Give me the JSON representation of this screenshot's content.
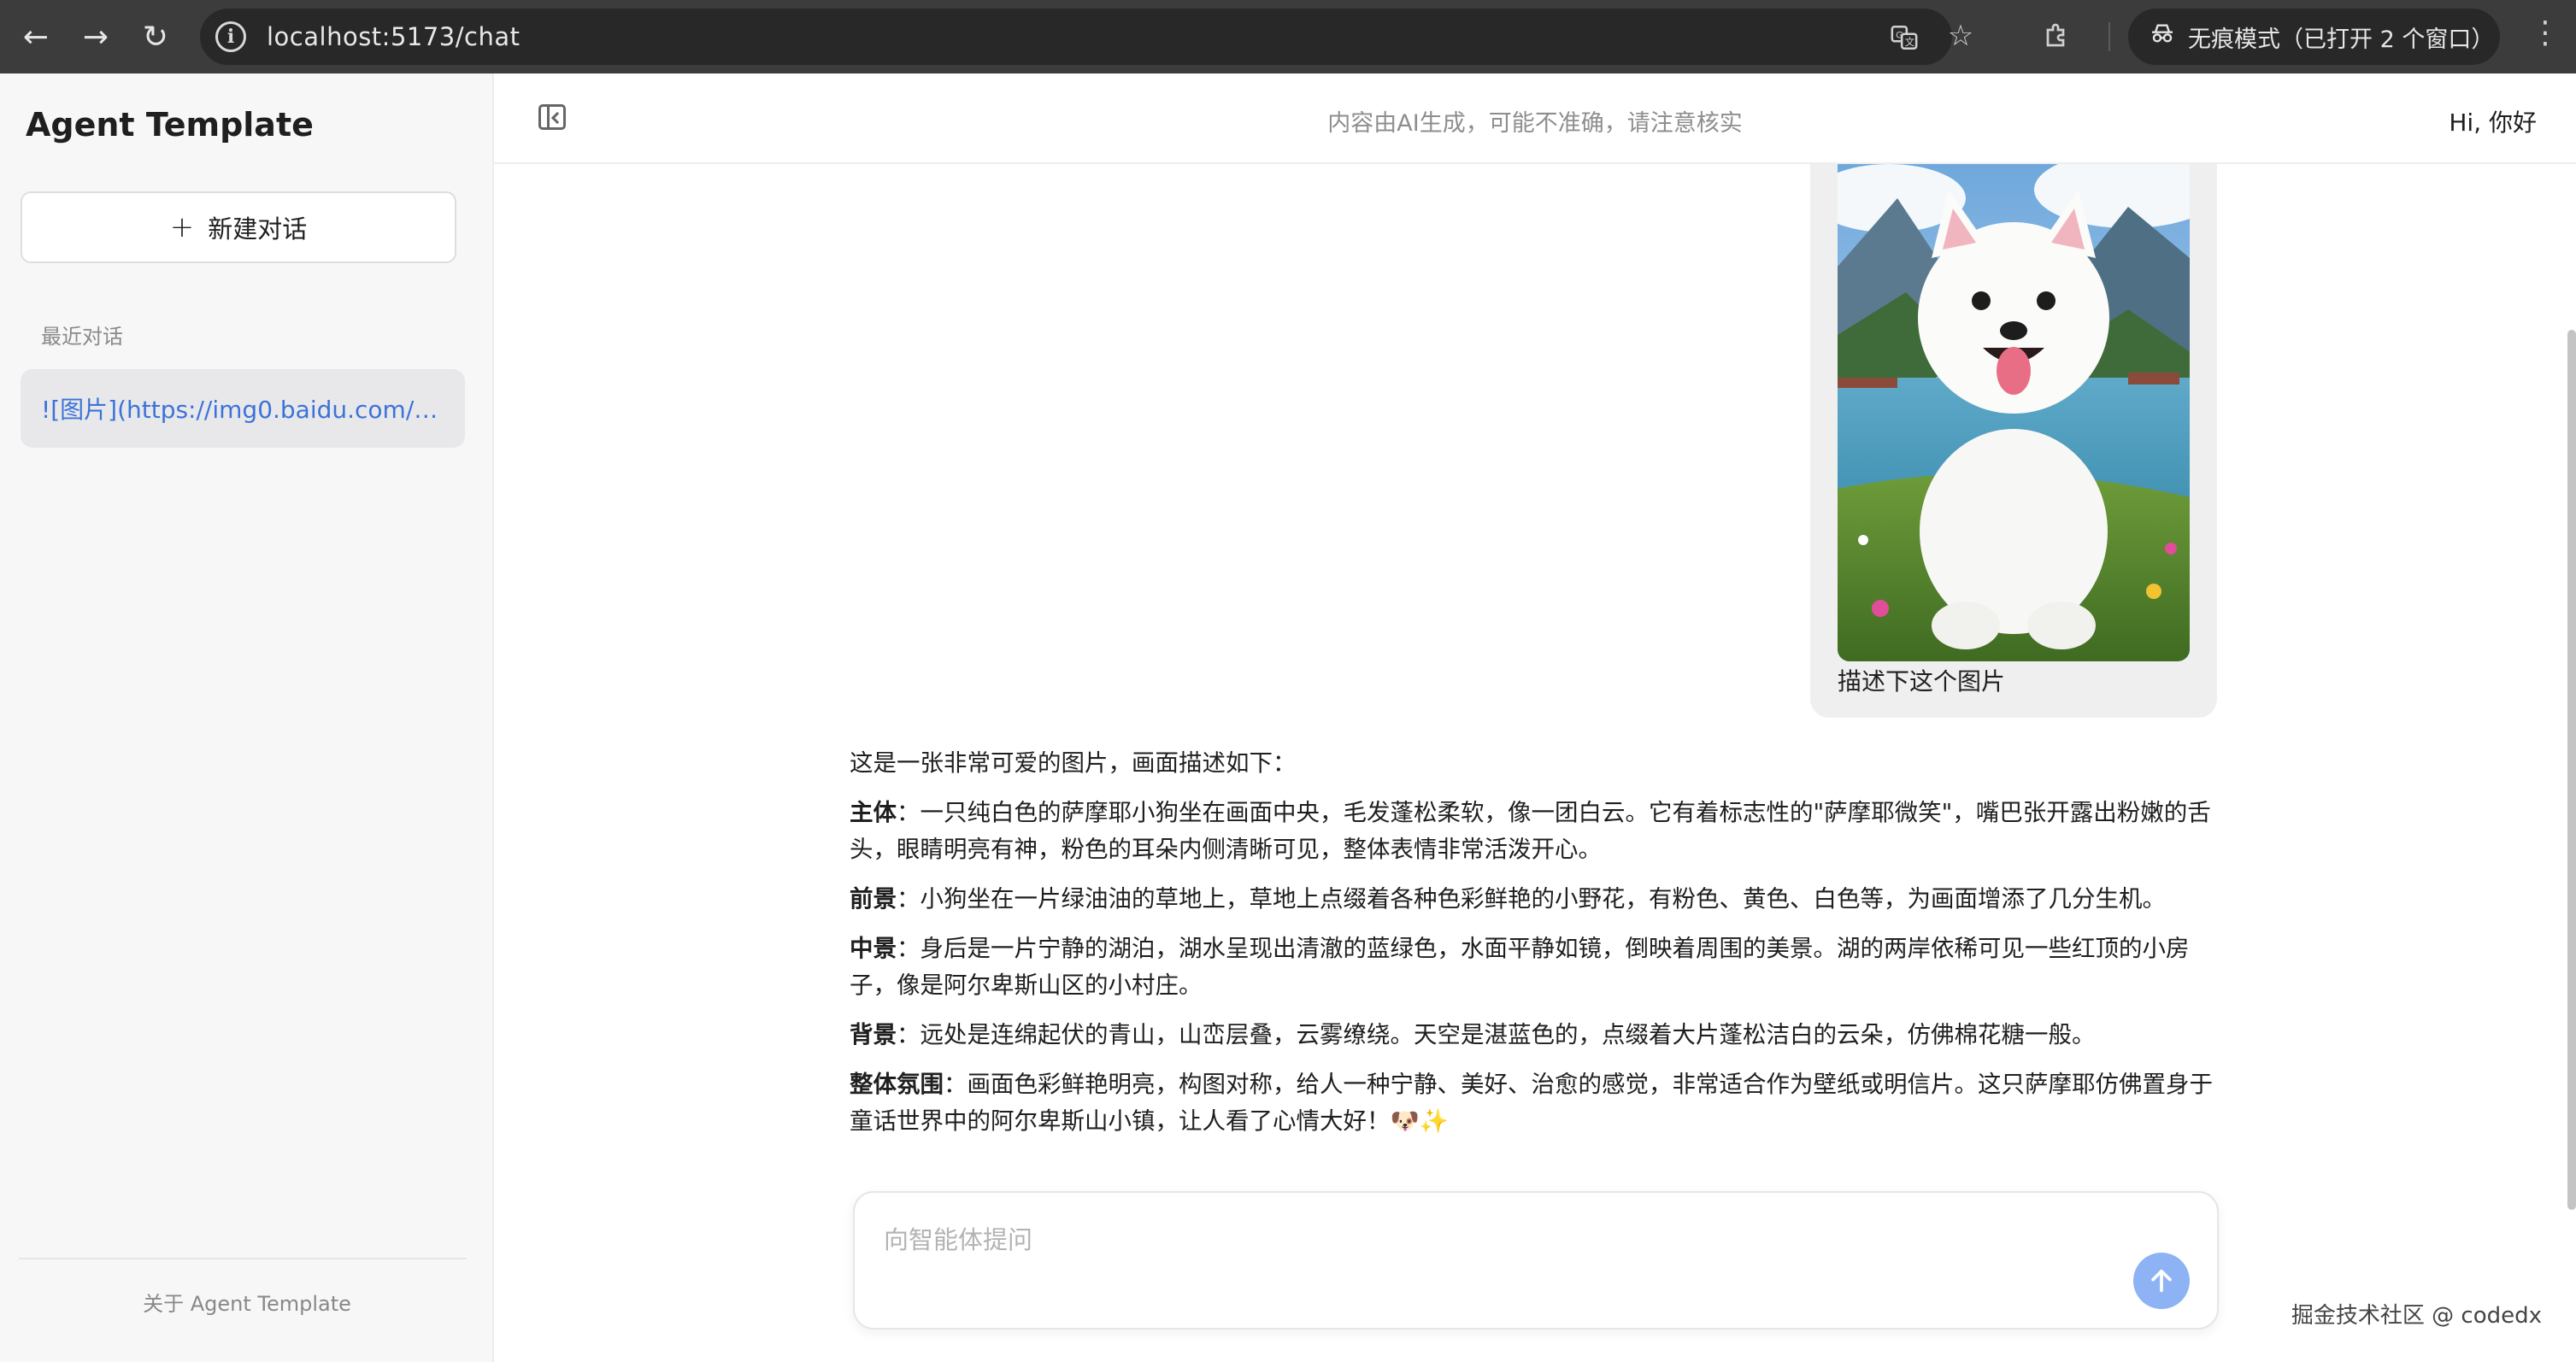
{
  "browser": {
    "back_icon": "arrow-left-icon",
    "forward_icon": "arrow-right-icon",
    "reload_icon": "reload-icon",
    "url": "localhost:5173/chat",
    "incognito_label": "无痕模式（已打开 2 个窗口）"
  },
  "sidebar": {
    "app_title": "Agent Template",
    "new_chat_label": "新建对话",
    "recent_label": "最近对话",
    "history": [
      {
        "label": "![图片](https://img0.baidu.com/it/u=..."
      }
    ],
    "about_label": "关于 Agent Template"
  },
  "header": {
    "disclaimer": "内容由AI生成，可能不准确，请注意核实",
    "greeting": "Hi, 你好"
  },
  "chat": {
    "user_message": {
      "image_alt": "white samoyed puppy sitting by a lake",
      "text": "描述下这个图片"
    },
    "answer": {
      "intro": "这是一张非常可爱的图片，画面描述如下：",
      "sections": [
        {
          "heading": "主体",
          "text": "：一只纯白色的萨摩耶小狗坐在画面中央，毛发蓬松柔软，像一团白云。它有着标志性的\"萨摩耶微笑\"，嘴巴张开露出粉嫩的舌头，眼睛明亮有神，粉色的耳朵内侧清晰可见，整体表情非常活泼开心。"
        },
        {
          "heading": "前景",
          "text": "：小狗坐在一片绿油油的草地上，草地上点缀着各种色彩鲜艳的小野花，有粉色、黄色、白色等，为画面增添了几分生机。"
        },
        {
          "heading": "中景",
          "text": "：身后是一片宁静的湖泊，湖水呈现出清澈的蓝绿色，水面平静如镜，倒映着周围的美景。湖的两岸依稀可见一些红顶的小房子，像是阿尔卑斯山区的小村庄。"
        },
        {
          "heading": "背景",
          "text": "：远处是连绵起伏的青山，山峦层叠，云雾缭绕。天空是湛蓝色的，点缀着大片蓬松洁白的云朵，仿佛棉花糖一般。"
        },
        {
          "heading": "整体氛围",
          "text": "：画面色彩鲜艳明亮，构图对称，给人一种宁静、美好、治愈的感觉，非常适合作为壁纸或明信片。这只萨摩耶仿佛置身于童话世界中的阿尔卑斯山小镇，让人看了心情大好！🐶✨"
        }
      ]
    }
  },
  "input": {
    "placeholder": "向智能体提问"
  },
  "watermark": "掘金技术社区 @ codedx",
  "colors": {
    "accent": "#3b73d9",
    "send_button": "#8db3f5",
    "sidebar_bg": "#f7f7f8"
  }
}
